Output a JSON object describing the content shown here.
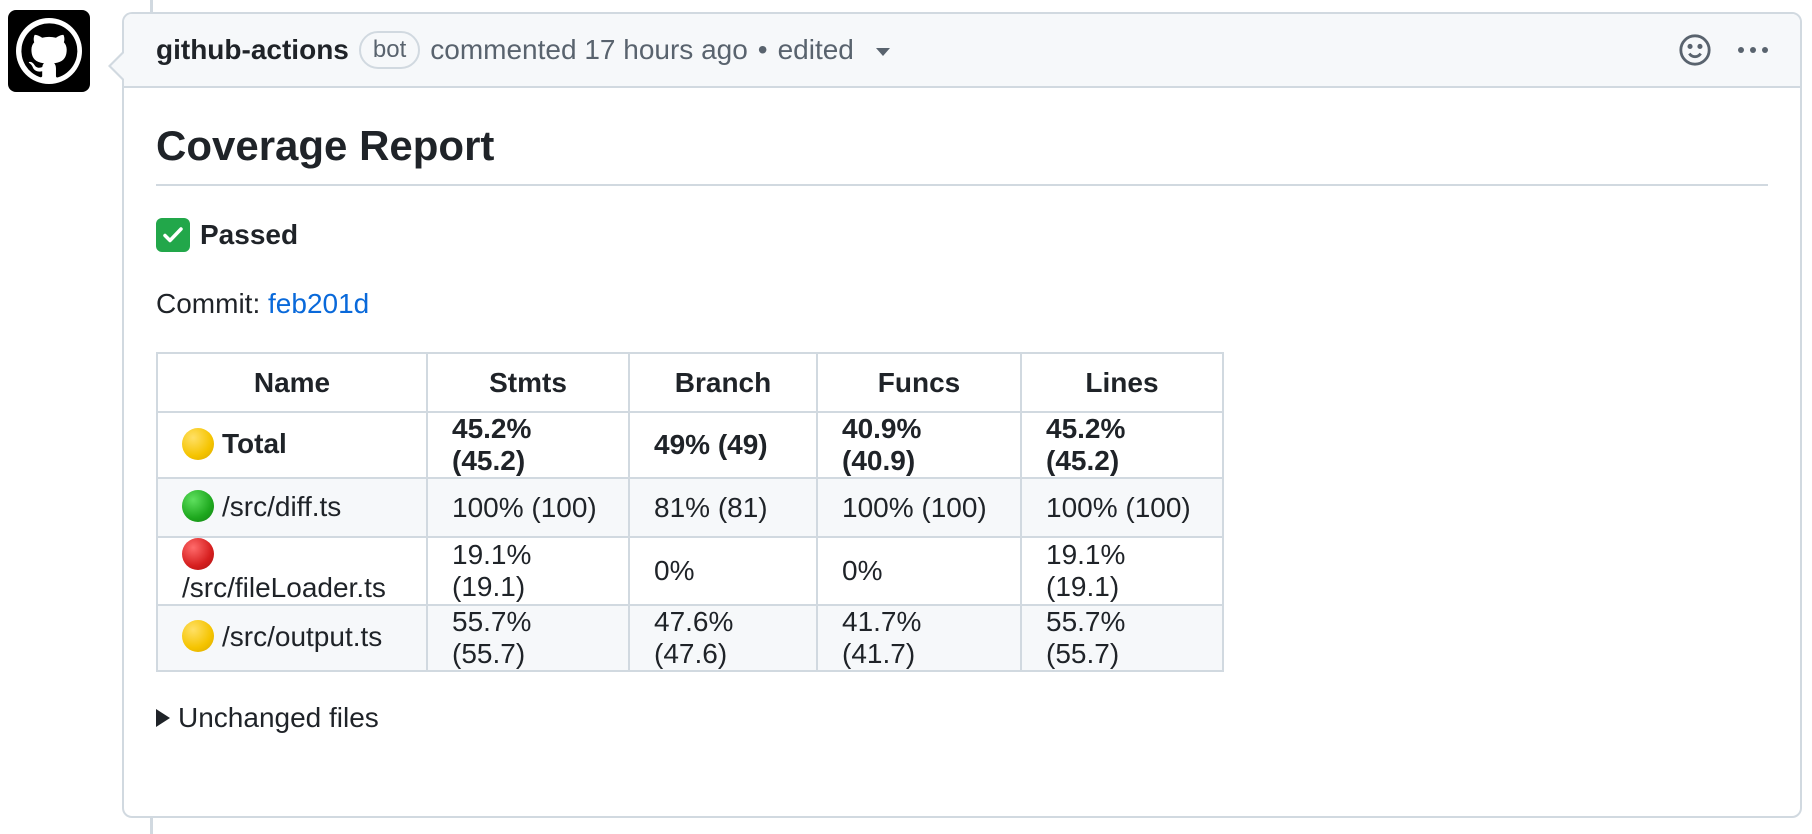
{
  "comment": {
    "author": "github-actions",
    "badge": "bot",
    "meta": "commented 17 hours ago",
    "separator": "•",
    "edited": "edited"
  },
  "report": {
    "title": "Coverage Report",
    "status": "Passed",
    "commit_label": "Commit:",
    "commit_hash": "feb201d",
    "details_summary": "Unchanged files"
  },
  "table": {
    "headers": [
      "Name",
      "Stmts",
      "Branch",
      "Funcs",
      "Lines"
    ],
    "rows": [
      {
        "status": "yellow",
        "name": "Total",
        "stmts": "45.2% (45.2)",
        "branch": "49% (49)",
        "funcs": "40.9% (40.9)",
        "lines": "45.2% (45.2)"
      },
      {
        "status": "green",
        "name": "/src/diff.ts",
        "stmts": "100% (100)",
        "branch": "81% (81)",
        "funcs": "100% (100)",
        "lines": "100% (100)"
      },
      {
        "status": "red",
        "name": "/src/fileLoader.ts",
        "stmts": "19.1% (19.1)",
        "branch": "0%",
        "funcs": "0%",
        "lines": "19.1% (19.1)"
      },
      {
        "status": "yellow",
        "name": "/src/output.ts",
        "stmts": "55.7% (55.7)",
        "branch": "47.6% (47.6)",
        "funcs": "41.7% (41.7)",
        "lines": "55.7% (55.7)"
      }
    ]
  },
  "icons": {
    "avatar": "github-octocat-icon",
    "reaction": "smiley-icon",
    "more": "kebab-icon",
    "status": "check-mark-icon",
    "edited_menu": "caret-down-icon",
    "details": "triangle-right-icon"
  },
  "colors": {
    "link": "#0969da",
    "border": "#d1d9e0",
    "header_bg": "#f6f8fa",
    "pass": "#22a74a"
  }
}
